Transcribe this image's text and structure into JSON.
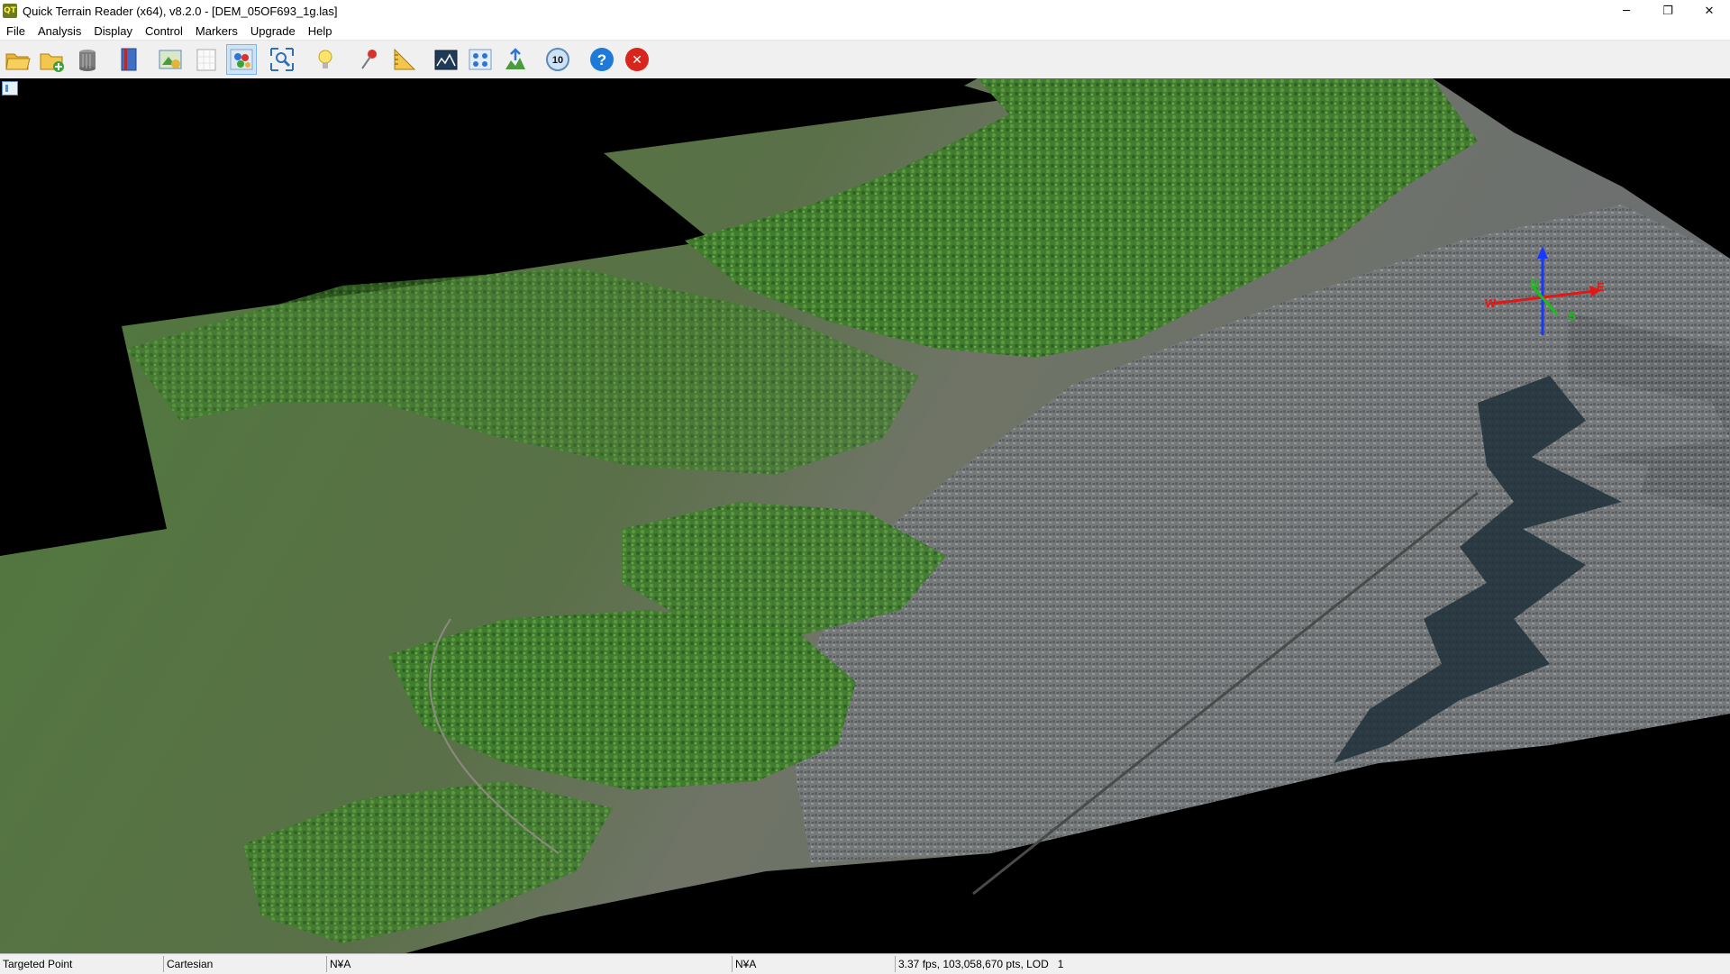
{
  "window": {
    "app_icon_text": "QT",
    "title": "Quick Terrain Reader (x64), v8.2.0 - [DEM_05OF693_1g.las]",
    "controls": {
      "minimize": "─",
      "restore": "❐",
      "close": "✕"
    }
  },
  "menu": {
    "items": [
      "File",
      "Analysis",
      "Display",
      "Control",
      "Markers",
      "Upgrade",
      "Help"
    ]
  },
  "toolbar": {
    "buttons": [
      {
        "name": "open-folder",
        "icon": "open-folder-icon"
      },
      {
        "name": "add-folder",
        "icon": "folder-add-icon"
      },
      {
        "name": "database",
        "icon": "database-icon"
      },
      {
        "name": "book",
        "icon": "book-icon"
      },
      {
        "name": "map-layers",
        "icon": "map-layers-icon"
      },
      {
        "name": "blank-document",
        "icon": "blank-document-icon"
      },
      {
        "name": "color-points",
        "icon": "color-points-icon",
        "active": true
      },
      {
        "name": "zoom-extents",
        "icon": "zoom-extents-icon"
      },
      {
        "name": "lighting",
        "icon": "lightbulb-icon"
      },
      {
        "name": "marker-pin",
        "icon": "pushpin-icon"
      },
      {
        "name": "measure",
        "icon": "ruler-icon"
      },
      {
        "name": "profile",
        "icon": "profile-icon"
      },
      {
        "name": "point-density",
        "icon": "point-density-icon"
      },
      {
        "name": "export-grid",
        "icon": "export-grid-icon"
      },
      {
        "name": "lod",
        "icon": "lod-icon",
        "label": "10"
      },
      {
        "name": "help",
        "icon": "help-icon",
        "label": "?"
      },
      {
        "name": "exit",
        "icon": "exit-icon",
        "label": "✕"
      }
    ]
  },
  "axis_gizmo": {
    "labels": {
      "north": "N",
      "east": "E",
      "south": "S",
      "west": "W"
    }
  },
  "status": {
    "mode": "Targeted Point",
    "coords": "Cartesian",
    "value1": "N¥A",
    "value2": "N¥A",
    "render_info": "3.37 fps, 103,058,670 pts, LOD   1"
  },
  "colors": {
    "accent": "#1e7ad6",
    "exit_red": "#d9261c",
    "forest": "#3f7d2c",
    "urban": "#7c7f82"
  }
}
